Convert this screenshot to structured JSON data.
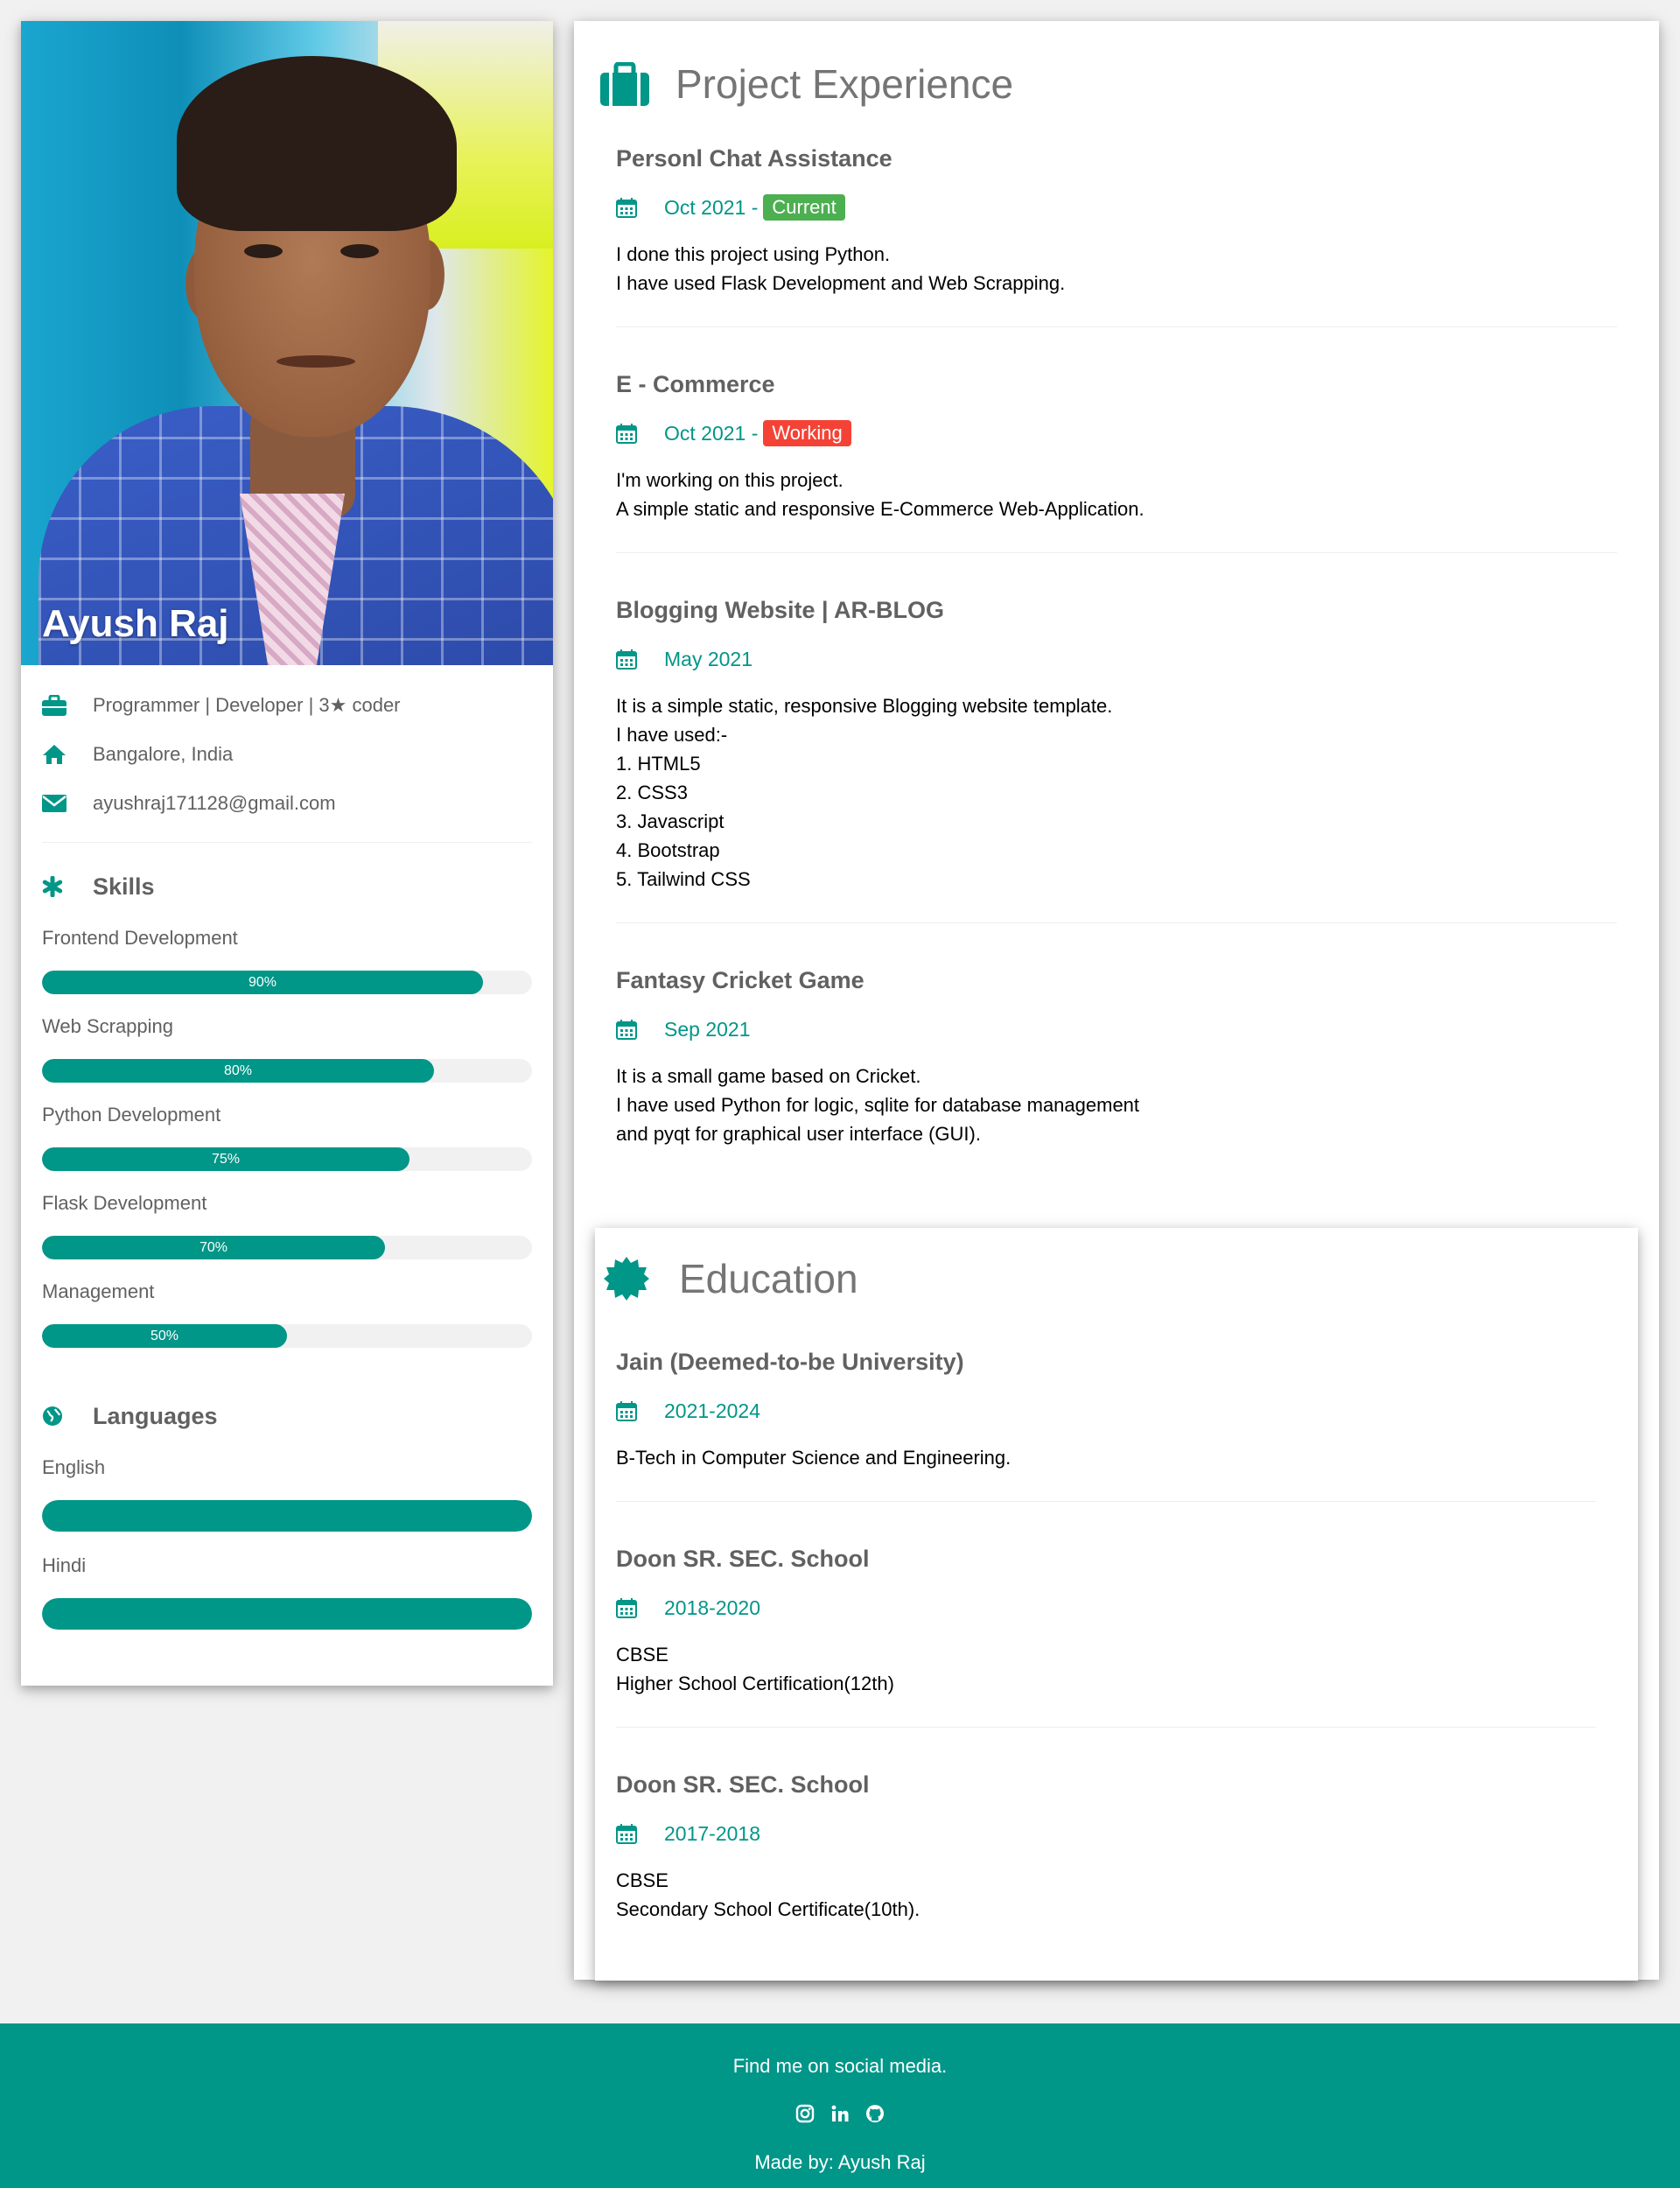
{
  "profile": {
    "name": "Ayush Raj",
    "title": "Programmer | Developer | 3★ coder",
    "location": "Bangalore, India",
    "email": "ayushraj171128@gmail.com"
  },
  "skills": {
    "heading": "Skills",
    "items": [
      {
        "label": "Frontend Development",
        "percent": 90,
        "percent_label": "90%"
      },
      {
        "label": "Web Scrapping",
        "percent": 80,
        "percent_label": "80%"
      },
      {
        "label": "Python Development",
        "percent": 75,
        "percent_label": "75%"
      },
      {
        "label": "Flask Development",
        "percent": 70,
        "percent_label": "70%"
      },
      {
        "label": "Management",
        "percent": 50,
        "percent_label": "50%"
      }
    ]
  },
  "languages": {
    "heading": "Languages",
    "items": [
      {
        "label": "English",
        "percent": 100
      },
      {
        "label": "Hindi",
        "percent": 100
      }
    ]
  },
  "projects": {
    "heading": "Project Experience",
    "items": [
      {
        "title": "Personl Chat Assistance",
        "date": "Oct 2021 -",
        "tag": "Current",
        "tag_color": "#4caf50",
        "lines": [
          "I done this project using Python.",
          "I have used Flask Development and Web Scrapping."
        ]
      },
      {
        "title": "E - Commerce",
        "date": "Oct 2021 -",
        "tag": "Working",
        "tag_color": "#f44336",
        "lines": [
          "I'm working on this project.",
          "A simple static and responsive E-Commerce Web-Application."
        ]
      },
      {
        "title": "Blogging Website | AR-BLOG",
        "date": "May 2021",
        "lines": [
          "It is a simple static, responsive Blogging website template.",
          "I have used:-",
          "1. HTML5",
          "2. CSS3",
          "3. Javascript",
          "4. Bootstrap",
          "5. Tailwind CSS"
        ]
      },
      {
        "title": "Fantasy Cricket Game",
        "date": "Sep 2021",
        "lines": [
          "It is a small game based on Cricket.",
          "I have used Python for logic, sqlite for database management",
          "and pyqt for graphical user interface (GUI)."
        ]
      }
    ]
  },
  "education": {
    "heading": "Education",
    "items": [
      {
        "title": "Jain (Deemed-to-be University)",
        "date": "2021-2024",
        "lines": [
          "B-Tech in Computer Science and Engineering."
        ]
      },
      {
        "title": "Doon SR. SEC. School",
        "date": "2018-2020",
        "lines": [
          "CBSE",
          "Higher School Certification(12th)"
        ]
      },
      {
        "title": "Doon SR. SEC. School",
        "date": "2017-2018",
        "lines": [
          "CBSE",
          "Secondary School Certificate(10th)."
        ]
      }
    ]
  },
  "footer": {
    "find_text": "Find me on social media.",
    "social_icons": [
      "instagram-icon",
      "linkedin-icon",
      "github-icon"
    ],
    "made_by": "Made by: Ayush Raj"
  },
  "colors": {
    "accent": "#009688",
    "current_tag": "#4caf50",
    "working_tag": "#f44336",
    "background": "#f1f1f1"
  }
}
